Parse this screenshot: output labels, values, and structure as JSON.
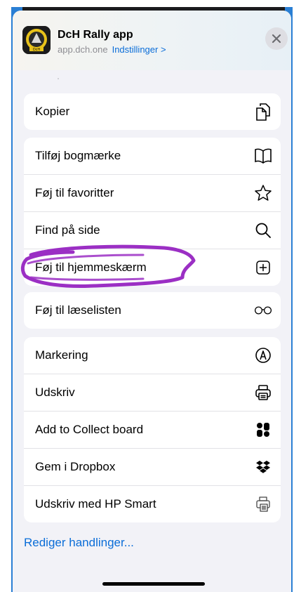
{
  "header": {
    "app_title": "DcH Rally app",
    "domain": "app.dch.one",
    "settings_link": "Indstillinger >",
    "app_icon_name": "dch-rally-logo-icon",
    "close_icon_name": "close-icon"
  },
  "groups": [
    {
      "items": [
        {
          "label": "Kopier",
          "icon": "copy-icon"
        }
      ]
    },
    {
      "items": [
        {
          "label": "Tilføj bogmærke",
          "icon": "book-icon"
        },
        {
          "label": "Føj til favoritter",
          "icon": "star-icon"
        },
        {
          "label": "Find på side",
          "icon": "search-icon"
        },
        {
          "label": "Føj til hjemmeskærm",
          "icon": "plus-square-icon"
        }
      ]
    },
    {
      "items": [
        {
          "label": "Føj til læselisten",
          "icon": "glasses-icon"
        }
      ]
    },
    {
      "items": [
        {
          "label": "Markering",
          "icon": "markup-icon"
        },
        {
          "label": "Udskriv",
          "icon": "printer-icon"
        },
        {
          "label": "Add to Collect board",
          "icon": "collect-icon"
        },
        {
          "label": "Gem i Dropbox",
          "icon": "dropbox-icon"
        },
        {
          "label": "Udskriv med HP Smart",
          "icon": "hp-print-icon"
        }
      ]
    }
  ],
  "footer": {
    "edit_actions": "Rediger handlinger..."
  },
  "colors": {
    "accent": "#0a6dd8",
    "sheet_background": "#f2f2f7",
    "annotation": "#9b2fc4"
  }
}
